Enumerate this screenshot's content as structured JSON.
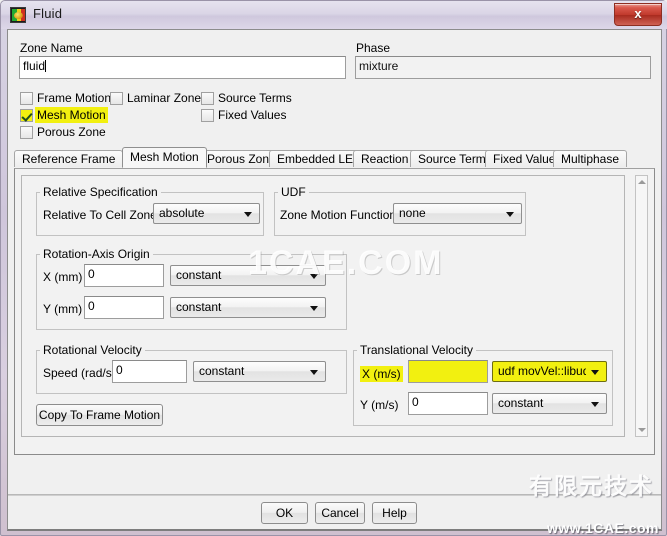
{
  "window": {
    "title": "Fluid",
    "icon": "fluent-app-icon",
    "close_label": "x"
  },
  "form": {
    "zone_name_label": "Zone Name",
    "zone_name_value": "fluid",
    "phase_label": "Phase",
    "phase_value": "mixture"
  },
  "checkboxes": [
    {
      "label": "Frame Motion",
      "checked": false,
      "highlighted": false
    },
    {
      "label": "Laminar Zone",
      "checked": false,
      "highlighted": false
    },
    {
      "label": "Source Terms",
      "checked": false,
      "highlighted": false
    },
    {
      "label": "Mesh Motion",
      "checked": true,
      "highlighted": true
    },
    {
      "label": "Fixed Values",
      "checked": false,
      "highlighted": false
    },
    {
      "label": "Porous Zone",
      "checked": false,
      "highlighted": false
    }
  ],
  "tabs": [
    {
      "label": "Reference Frame",
      "active": false
    },
    {
      "label": "Mesh Motion",
      "active": true
    },
    {
      "label": "Porous Zone",
      "active": false
    },
    {
      "label": "Embedded LES",
      "active": false
    },
    {
      "label": "Reaction",
      "active": false
    },
    {
      "label": "Source Terms",
      "active": false
    },
    {
      "label": "Fixed Values",
      "active": false
    },
    {
      "label": "Multiphase",
      "active": false
    }
  ],
  "relative_specification": {
    "group_title": "Relative Specification",
    "field_label": "Relative To Cell Zone",
    "value": "absolute"
  },
  "udf": {
    "group_title": "UDF",
    "field_label": "Zone Motion Function",
    "value": "none"
  },
  "rotation_axis_origin": {
    "group_title": "Rotation-Axis Origin",
    "rows": [
      {
        "label": "X (mm)",
        "value": "0",
        "method": "constant"
      },
      {
        "label": "Y (mm)",
        "value": "0",
        "method": "constant"
      }
    ]
  },
  "rotational_velocity": {
    "group_title": "Rotational Velocity",
    "rows": [
      {
        "label": "Speed (rad/s)",
        "value": "0",
        "method": "constant"
      }
    ],
    "copy_button": "Copy To Frame Motion"
  },
  "translational_velocity": {
    "group_title": "Translational Velocity",
    "rows": [
      {
        "label": "X (m/s)",
        "value": "",
        "method": "udf movVel::libudf",
        "highlighted": true
      },
      {
        "label": "Y (m/s)",
        "value": "0",
        "method": "constant",
        "highlighted": false
      }
    ]
  },
  "dialog_buttons": {
    "ok": "OK",
    "cancel": "Cancel",
    "help": "Help"
  },
  "watermark": {
    "center": "1CAE.COM",
    "chinese": "有限元技术",
    "url": "www.1CAE.com"
  },
  "colors": {
    "highlight": "#f2f010",
    "titlebar": "#dad5e6",
    "close_button": "#c0392c",
    "dialog_bg": "#f0f0f0"
  }
}
